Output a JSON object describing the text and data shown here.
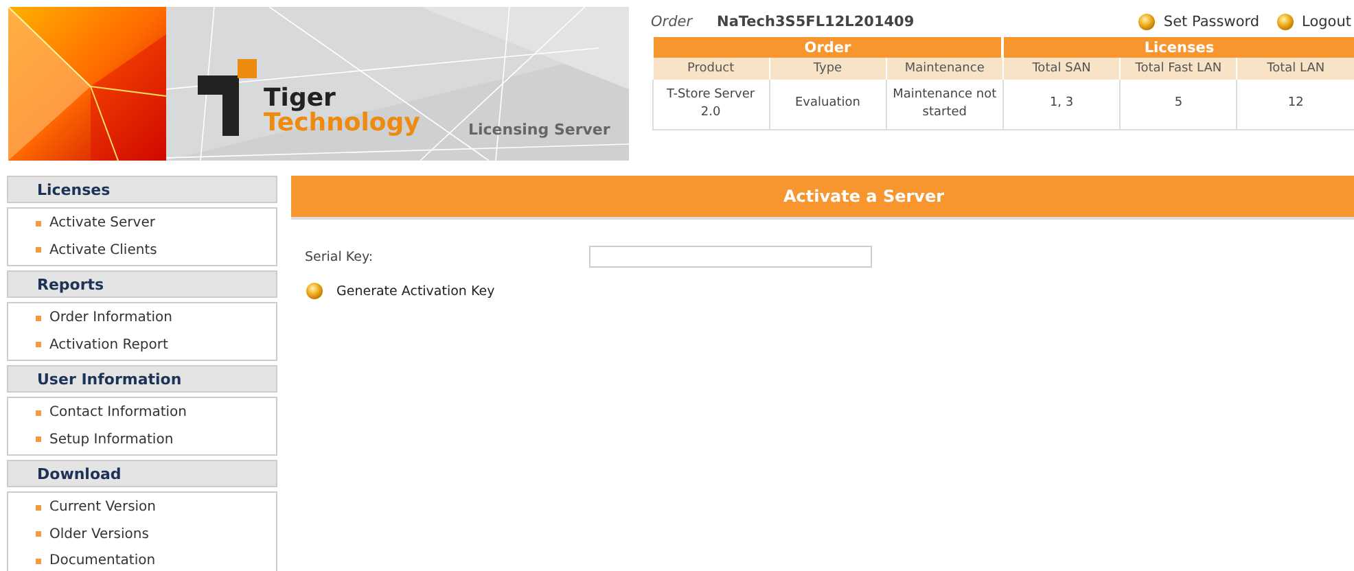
{
  "banner": {
    "logo_top": "Tiger",
    "logo_bottom": "Technology",
    "subtitle": "Licensing Server"
  },
  "order": {
    "label": "Order",
    "number": "NaTech3S5FL12L201409"
  },
  "account_links": [
    "Set Password",
    "Logout"
  ],
  "order_table": {
    "groups": [
      {
        "title": "Order",
        "columns": [
          "Product",
          "Type",
          "Maintenance"
        ]
      },
      {
        "title": "Licenses",
        "columns": [
          "Total SAN",
          "Total Fast LAN",
          "Total LAN"
        ]
      }
    ],
    "rows": [
      [
        "T-Store Server 2.0",
        "Evaluation",
        "Maintenance not started",
        "1, 3",
        "5",
        "12"
      ]
    ]
  },
  "sidebar": [
    {
      "title": "Licenses",
      "items": [
        "Activate Server",
        "Activate Clients"
      ]
    },
    {
      "title": "Reports",
      "items": [
        "Order Information",
        "Activation Report"
      ]
    },
    {
      "title": "User Information",
      "items": [
        "Contact Information",
        "Setup Information"
      ]
    },
    {
      "title": "Download",
      "items": [
        "Current Version",
        "Older Versions",
        "Documentation"
      ]
    }
  ],
  "main": {
    "title": "Activate a Server",
    "field_label": "Serial Key:",
    "action": "Generate Activation Key"
  }
}
